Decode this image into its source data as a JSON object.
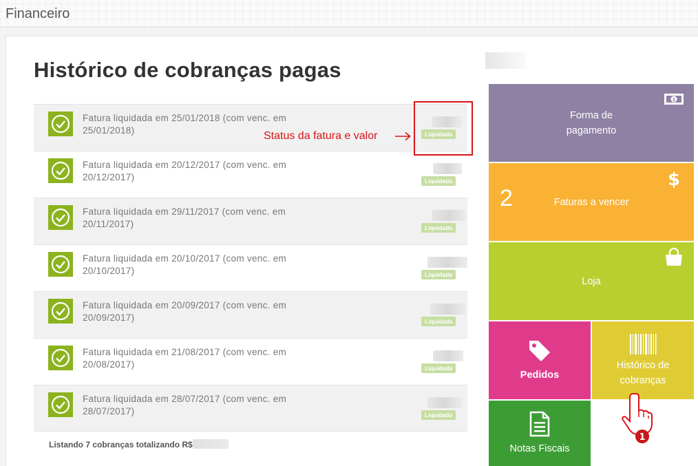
{
  "header": {
    "title": "Financeiro"
  },
  "page": {
    "title": "Histórico de cobranças pagas"
  },
  "invoices": [
    {
      "text": "Fatura liquidada em 25/01/2018 (com venc. em 25/01/2018)",
      "status": "Liquidada"
    },
    {
      "text": "Fatura liquidada em 20/12/2017 (com venc. em 20/12/2017)",
      "status": "Liquidada"
    },
    {
      "text": "Fatura liquidada em 29/11/2017 (com venc. em 20/11/2017)",
      "status": "Liquidada"
    },
    {
      "text": "Fatura liquidada em 20/10/2017 (com venc. em 20/10/2017)",
      "status": "Liquidada"
    },
    {
      "text": "Fatura liquidada em 20/09/2017 (com venc. em 20/09/2017)",
      "status": "Liquidada"
    },
    {
      "text": "Fatura liquidada em 21/08/2017 (com venc. em 20/08/2017)",
      "status": "Liquidada"
    },
    {
      "text": "Fatura liquidada em 28/07/2017 (com venc. em 28/07/2017)",
      "status": "Liquidada"
    }
  ],
  "summary": {
    "label": "Listando 7 cobranças totalizando R$"
  },
  "annotation": {
    "text": "Status da fatura e valor",
    "marker": "1"
  },
  "tiles": {
    "payment": {
      "label_line1": "Forma de",
      "label_line2": "pagamento",
      "icon": "money-icon",
      "color": "#8e81a3"
    },
    "due": {
      "label": "Faturas a vencer",
      "count": "2",
      "icon": "dollar-icon",
      "color": "#f9b233"
    },
    "store": {
      "label": "Loja",
      "icon": "shopping-bag-icon",
      "color": "#b9cf2f"
    },
    "orders": {
      "label": "Pedidos",
      "icon": "tag-icon",
      "color": "#e03b8b"
    },
    "history": {
      "label_line1": "Histórico de",
      "label_line2": "cobranças",
      "icon": "barcode-icon",
      "color": "#dfcc35"
    },
    "invoices": {
      "label": "Notas Fiscais",
      "icon": "document-icon",
      "color": "#3c9d35"
    }
  },
  "colors": {
    "check": "#8cb31e",
    "badge": "#c7dea3",
    "annotation": "#d71418"
  }
}
